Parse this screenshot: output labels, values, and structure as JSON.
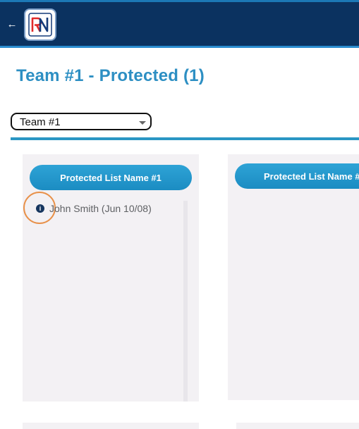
{
  "header": {
    "back_glyph": "←",
    "logo_icon": "rn-logo-icon",
    "logo_letters": "RN",
    "brand_colors": {
      "bar": "#0b3260",
      "accent": "#2a8ccf",
      "logo_red": "#e12b2b",
      "logo_blue": "#143a79"
    }
  },
  "page": {
    "title": "Team #1 - Protected (1)",
    "title_color": "#2d8fc3"
  },
  "team_select": {
    "value": "Team #1"
  },
  "lists": [
    {
      "name": "Protected List Name #1",
      "players": [
        {
          "icon": "info-icon",
          "icon_glyph": "i",
          "label": "John Smith (Jun 10/08)"
        }
      ]
    },
    {
      "name": "Protected List Name #"
    }
  ]
}
